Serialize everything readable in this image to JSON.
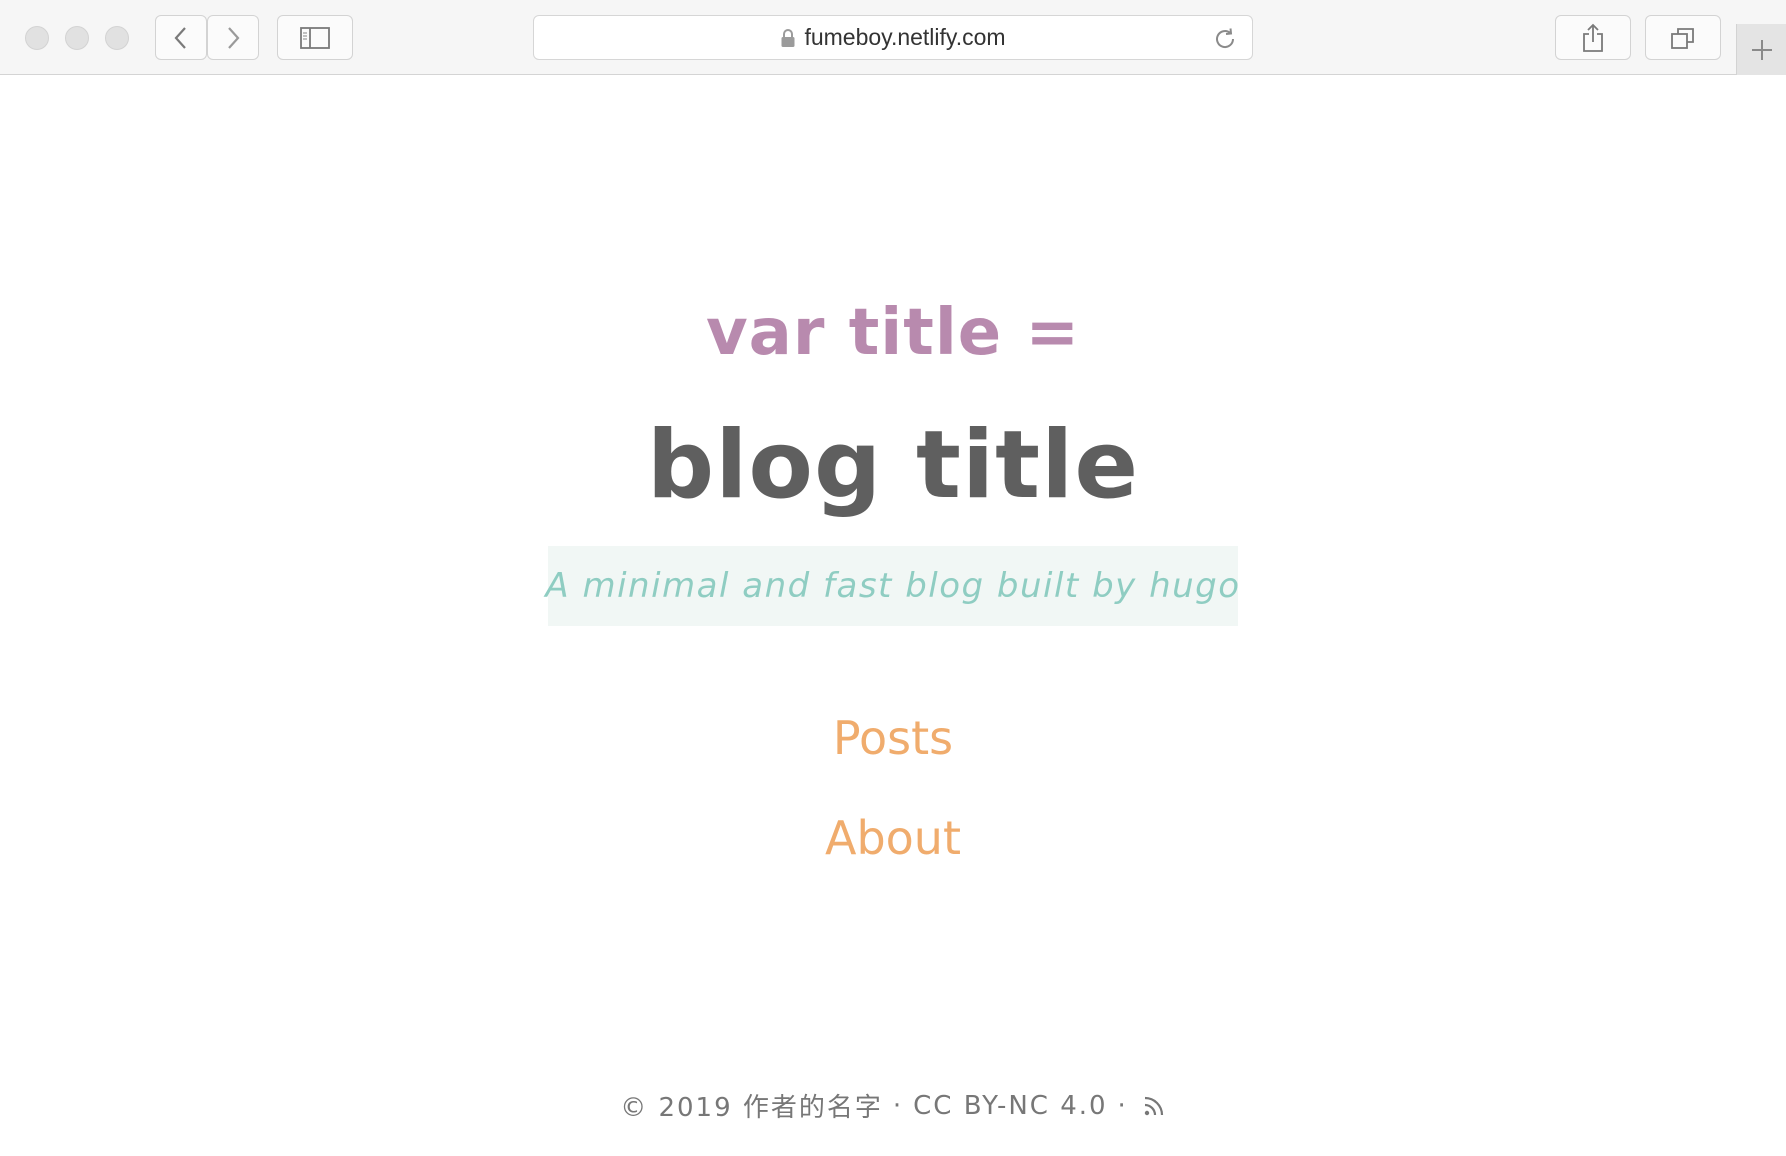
{
  "browser": {
    "url": "fumeboy.netlify.com",
    "icons": {
      "back": "chevron-left-icon",
      "forward": "chevron-right-icon",
      "sidebar": "sidebar-icon",
      "lock": "lock-icon",
      "reload": "reload-icon",
      "share": "share-icon",
      "tabs": "tabs-icon",
      "new_tab": "plus-icon"
    }
  },
  "header": {
    "var_line": "var title =",
    "title": "blog title",
    "tagline": "A minimal and fast blog built by hugo"
  },
  "nav": {
    "items": [
      {
        "label": "Posts"
      },
      {
        "label": "About"
      }
    ]
  },
  "footer": {
    "copyright": "© 2019 作者的名字",
    "separator": "·",
    "license": "CC BY-NC 4.0",
    "rss_icon": "rss-icon"
  },
  "colors": {
    "var_line": "#b88aae",
    "title": "#5f5f5f",
    "tagline": "#8fcdc2",
    "tagline_bg": "#f1f7f5",
    "nav_link": "#f0ac6d",
    "footer": "#777777"
  }
}
